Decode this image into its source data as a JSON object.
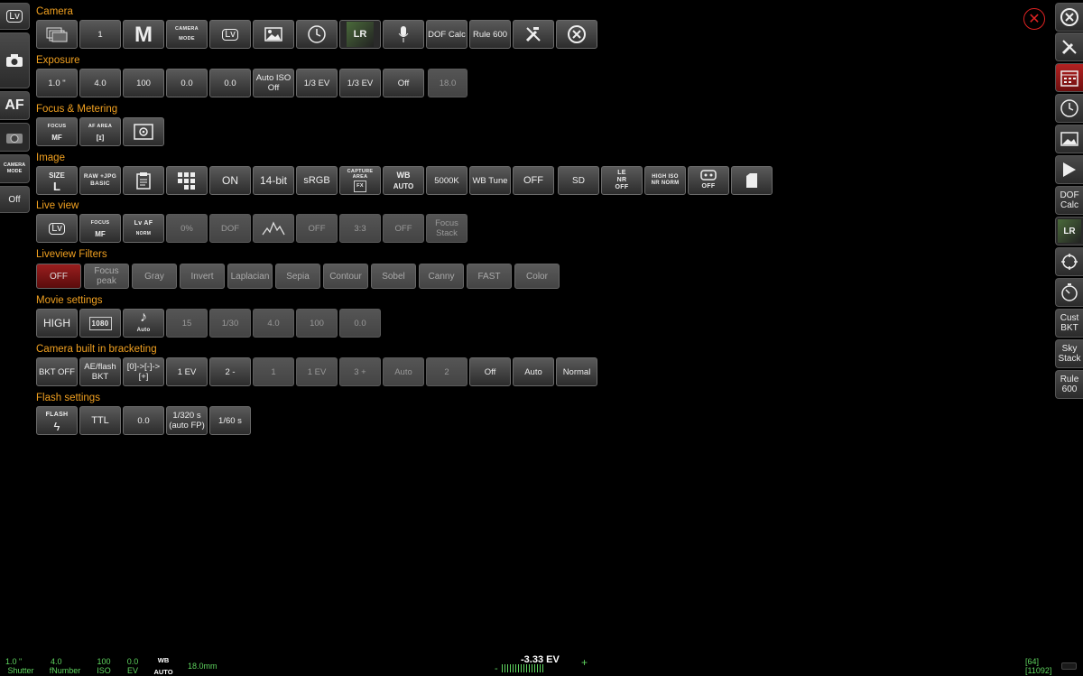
{
  "left_rail": {
    "lv": "Lv",
    "camera_mode": "CAMERA MODE",
    "off": "Off",
    "af": "AF"
  },
  "sections": {
    "camera": "Camera",
    "exposure": "Exposure",
    "focus": "Focus & Metering",
    "image": "Image",
    "liveview": "Live view",
    "filters": "Liveview Filters",
    "movie": "Movie settings",
    "bracketing": "Camera built in bracketing",
    "flash": "Flash settings"
  },
  "camera": {
    "count": "1",
    "mode": "M",
    "camera_mode_label": "CAMERA MODE",
    "lv": "Lv",
    "dof_calc": "DOF Calc",
    "rule600": "Rule 600"
  },
  "exposure": {
    "shutter": "1.0 \"",
    "aperture": "4.0",
    "iso": "100",
    "ev1": "0.0",
    "ev2": "0.0",
    "auto_iso": "Auto ISO Off",
    "step1": "1/3 EV",
    "step2": "1/3 EV",
    "off": "Off",
    "focal": "18.0"
  },
  "focus": {
    "focus_label": "FOCUS",
    "focus_value": "MF",
    "af_area_label": "AF AREA",
    "af_area_value": "[ɪ]"
  },
  "image": {
    "size_label": "SIZE",
    "size_value": "L",
    "raw": "RAW +JPG BASIC",
    "on": "ON",
    "bit": "14-bit",
    "srgb": "sRGB",
    "capture_area": "CAPTURE AREA",
    "capture_fx": "FX",
    "wb_label": "WB",
    "wb_value": "AUTO",
    "kelvin": "5000K",
    "wb_tune": "WB Tune",
    "off": "OFF",
    "sd": "SD",
    "le_nr": "LE NR OFF",
    "high_iso": "HIGH ISO NR NORM",
    "off2": "OFF"
  },
  "liveview": {
    "lv": "Lv",
    "focus_label": "FOCUS",
    "focus_value": "MF",
    "lvaf_label": "Lv AF",
    "lvaf_sub": "NORM",
    "pct": "0%",
    "dof": "DOF",
    "off": "OFF",
    "ratio": "3:3",
    "off2": "OFF",
    "focus_stack": "Focus Stack"
  },
  "filters": [
    "OFF",
    "Focus peak",
    "Gray",
    "Invert",
    "Laplacian",
    "Sepia",
    "Contour",
    "Sobel",
    "Canny",
    "FAST",
    "Color"
  ],
  "movie": {
    "quality": "HIGH",
    "res": "1080",
    "auto": "Auto",
    "fps": "15",
    "shutter": "1/30",
    "aperture": "4.0",
    "iso": "100",
    "ev": "0.0"
  },
  "bracketing": {
    "bkt_off": "BKT OFF",
    "ae_flash": "AE/flash BKT",
    "order": "[0]->[-]->[+]",
    "step": "1 EV",
    "count": "2 -",
    "one": "1",
    "ev": "1 EV",
    "three": "3 +",
    "auto": "Auto",
    "two": "2",
    "off": "Off",
    "auto2": "Auto",
    "normal": "Normal"
  },
  "flash": {
    "flash_label": "FLASH",
    "ttl": "TTL",
    "comp": "0.0",
    "sync": "1/320 s (auto FP)",
    "slow": "1/60 s"
  },
  "right_rail": {
    "dof_calc": "DOF Calc",
    "cust_bkt": "Cust BKT",
    "sky_stack": "Sky Stack",
    "rule600": "Rule 600"
  },
  "status": {
    "shutter_val": "1.0 \"",
    "shutter_lbl": "Shutter",
    "fnum_val": "4.0",
    "fnum_lbl": "fNumber",
    "iso_val": "100",
    "iso_lbl": "ISO",
    "ev_val": "0.0",
    "ev_lbl": "EV",
    "wb_val": "WB",
    "wb_lbl": "AUTO",
    "focal": "18.0mm",
    "ev_reading": "-3.33 EV",
    "minus": "-",
    "plus": "+",
    "shots": "[64]",
    "remaining": "[11092]"
  }
}
